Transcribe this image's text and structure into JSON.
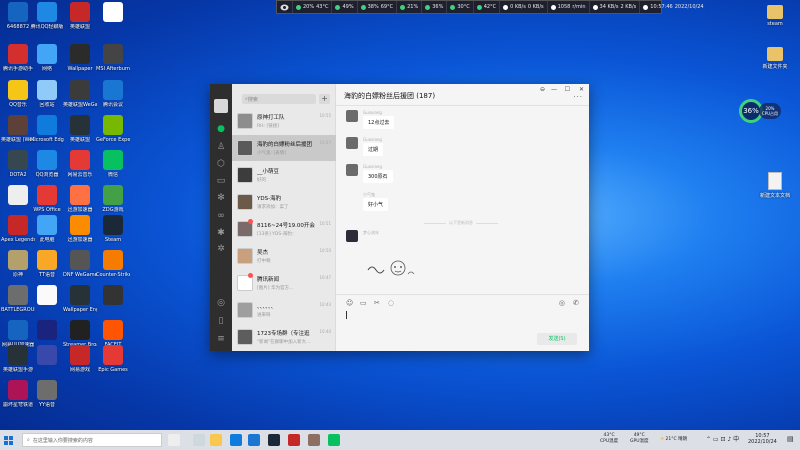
{
  "desktop": {
    "icons_left": [
      {
        "label": "6468872",
        "color": "#1565c0"
      },
      {
        "label": "腾讯QQ轻聊版",
        "color": "#1e88e5"
      },
      {
        "label": "英雄联盟",
        "color": "#c62828"
      },
      {
        "label": "",
        "color": "#ffffff"
      },
      {
        "label": "腾讯手游助手",
        "color": "#d32f2f"
      },
      {
        "label": "网络",
        "color": "#42a5f5"
      },
      {
        "label": "Wallpaper",
        "color": "#2b2b2b"
      },
      {
        "label": "MSI Afterburner",
        "color": "#444444"
      },
      {
        "label": "QQ音乐",
        "color": "#f5c518"
      },
      {
        "label": "回收站",
        "color": "#90caf9"
      },
      {
        "label": "英雄联盟WeGame版",
        "color": "#3b3b3b"
      },
      {
        "label": "腾讯会议",
        "color": "#1976d2"
      },
      {
        "label": "英雄联盟 (WeGame)",
        "color": "#5d4037"
      },
      {
        "label": "Microsoft Edge",
        "color": "#0f7bdc"
      },
      {
        "label": "英雄联盟",
        "color": "#263238"
      },
      {
        "label": "GeForce Experience",
        "color": "#76b900"
      },
      {
        "label": "DOTA2",
        "color": "#37474f"
      },
      {
        "label": "QQ浏览器",
        "color": "#1e88e5"
      },
      {
        "label": "网易云音乐",
        "color": "#e53935"
      },
      {
        "label": "微信",
        "color": "#07c160"
      },
      {
        "label": "",
        "color": "#eeeeee"
      },
      {
        "label": "WPS Office",
        "color": "#e53935"
      },
      {
        "label": "迅游加速器",
        "color": "#ff7043"
      },
      {
        "label": "ZDG游戏",
        "color": "#43a047"
      },
      {
        "label": "Apex Legends",
        "color": "#c62828"
      },
      {
        "label": "此电脑",
        "color": "#42a5f5"
      },
      {
        "label": "迅游加速器",
        "color": "#fb8c00"
      },
      {
        "label": "Steam",
        "color": "#1b2838"
      },
      {
        "label": "原神",
        "color": "#b3a06b"
      },
      {
        "label": "TT语音",
        "color": "#f9a825"
      },
      {
        "label": "DNF WeGame",
        "color": "#555555"
      },
      {
        "label": "Counter-Strike",
        "color": "#f57c00"
      },
      {
        "label": "BATTLEGROUNDS",
        "color": "#6d6d6d"
      },
      {
        "label": "",
        "color": "#fafafa"
      },
      {
        "label": "Wallpaper Engine",
        "color": "#263238"
      },
      {
        "label": "",
        "color": "#333333"
      },
      {
        "label": "网易UU加速器",
        "color": "#1565c0"
      },
      {
        "label": "",
        "color": "#1a237e"
      },
      {
        "label": "Streamer Broadcaster",
        "color": "#212121"
      },
      {
        "label": "FACEIT",
        "color": "#ff5500"
      },
      {
        "label": "英雄联盟手游",
        "color": "#263238"
      },
      {
        "label": "",
        "color": "#3949ab"
      },
      {
        "label": "网易游戏",
        "color": "#c62828"
      },
      {
        "label": "Epic Games",
        "color": "#e53935"
      },
      {
        "label": "崩坏星穹铁道",
        "color": "#ad1457"
      },
      {
        "label": "YY语音",
        "color": "#6d6d6d"
      }
    ],
    "icons_right": [
      {
        "label": "steam",
        "type": "folder"
      },
      {
        "label": "新建文件夹",
        "type": "folder"
      },
      {
        "label": "新建文本文档",
        "type": "file"
      }
    ]
  },
  "statbar": {
    "segments": [
      {
        "text": "20%",
        "sub": "43°C",
        "color": "#3fd17e"
      },
      {
        "text": "49%",
        "sub": "",
        "color": "#3fd17e"
      },
      {
        "text": "38%",
        "sub": "69°C",
        "color": "#3fd17e"
      },
      {
        "text": "21%",
        "sub": "",
        "color": "#3fd17e"
      },
      {
        "text": "36%",
        "sub": "",
        "color": "#3fd17e"
      },
      {
        "text": "30°C",
        "sub": "",
        "color": "#3fd17e"
      },
      {
        "text": "42°C",
        "sub": "",
        "color": "#3fd17e"
      },
      {
        "text": "0 KB/s",
        "sub": "0 KB/s",
        "color": "#ffffff"
      },
      {
        "text": "1058",
        "sub": "r/min",
        "color": "#ffffff"
      },
      {
        "text": "34 KB/s",
        "sub": "2 KB/s",
        "color": "#ffffff"
      },
      {
        "text": "10:57:46",
        "sub": "2022/10/24",
        "color": "#ffffff"
      }
    ]
  },
  "wechat": {
    "window_controls": [
      "⊖",
      "—",
      "☐",
      "✕"
    ],
    "search_placeholder": "搜索",
    "plus_label": "+",
    "chat_title": "海豹的白嫖粉丝后援团 (187)",
    "more_label": "···",
    "chats": [
      {
        "name": "原神打工队",
        "msg": "RH: [链接]",
        "time": "10:55",
        "color": "#8d8d8d",
        "badge": false
      },
      {
        "name": "海豹的白嫖粉丝后援团",
        "msg": "小气鬼: [表情]",
        "time": "10:57",
        "color": "#5a5a5a",
        "badge": false
      },
      {
        "name": "__小萌豆",
        "msg": "好的",
        "time": "",
        "color": "#3c3c3c",
        "badge": false
      },
      {
        "name": "YDS-海豹",
        "msg": "请求添加：菜了",
        "time": "",
        "color": "#6b5a4a",
        "badge": false
      },
      {
        "name": "8116~24号19.00开会",
        "msg": "[13条] YDS-海豹：",
        "time": "10:51",
        "color": "#7a6a6a",
        "badge": true
      },
      {
        "name": "吴杰",
        "msg": "打中啊",
        "time": "10:50",
        "color": "#c9a07d",
        "badge": false
      },
      {
        "name": "腾讯新闻",
        "msg": "[图片] 华为官方...",
        "time": "10:47",
        "color": "#ffffff",
        "badge": true
      },
      {
        "name": "、、、、、、",
        "msg": "进来呀",
        "time": "10:43",
        "color": "#9e9e9e",
        "badge": false
      },
      {
        "name": "1723专场群（专注逛",
        "msg": "\"新闻\"在群聊中加入新大...",
        "time": "10:40",
        "color": "#5d5d5d",
        "badge": false
      }
    ],
    "messages": [
      {
        "sender": "Guoxiang",
        "text": "12点过去"
      },
      {
        "sender": "Guoxiang",
        "text": "过期"
      },
      {
        "sender": "Guoxiang",
        "text": "300原石"
      },
      {
        "sender": "小气鬼",
        "text": "好小气"
      }
    ],
    "divider_text": "以下是新消息",
    "sticker_sender": "梦心流年",
    "send_label": "发送(S)",
    "input_tools": [
      "☺",
      "▭",
      "✂",
      "◌"
    ],
    "input_tools_right": [
      "◎",
      "✆"
    ]
  },
  "gauge": {
    "value": "36%",
    "line1": "20%",
    "line2": "CPU占用",
    "color": "#3fd17e"
  },
  "taskbar": {
    "search_placeholder": "在这里输入你要搜索的内容",
    "apps": [
      {
        "name": "search-app",
        "color": "#eeeeee"
      },
      {
        "name": "task-view",
        "color": "#cfd8dc"
      },
      {
        "name": "explorer",
        "color": "#f9c74f"
      },
      {
        "name": "edge",
        "color": "#0f7bdc"
      },
      {
        "name": "store",
        "color": "#1976d2"
      },
      {
        "name": "steam",
        "color": "#1b2838"
      },
      {
        "name": "wegame",
        "color": "#c62828"
      },
      {
        "name": "lol",
        "color": "#8d6e63"
      },
      {
        "name": "wechat",
        "color": "#07c160"
      }
    ],
    "temp1_value": "43°C",
    "temp1_label": "CPU温度",
    "temp2_value": "49°C",
    "temp2_label": "GPU温度",
    "weather": "21°C 晴朗",
    "time": "10:57",
    "date": "2022/10/24"
  }
}
